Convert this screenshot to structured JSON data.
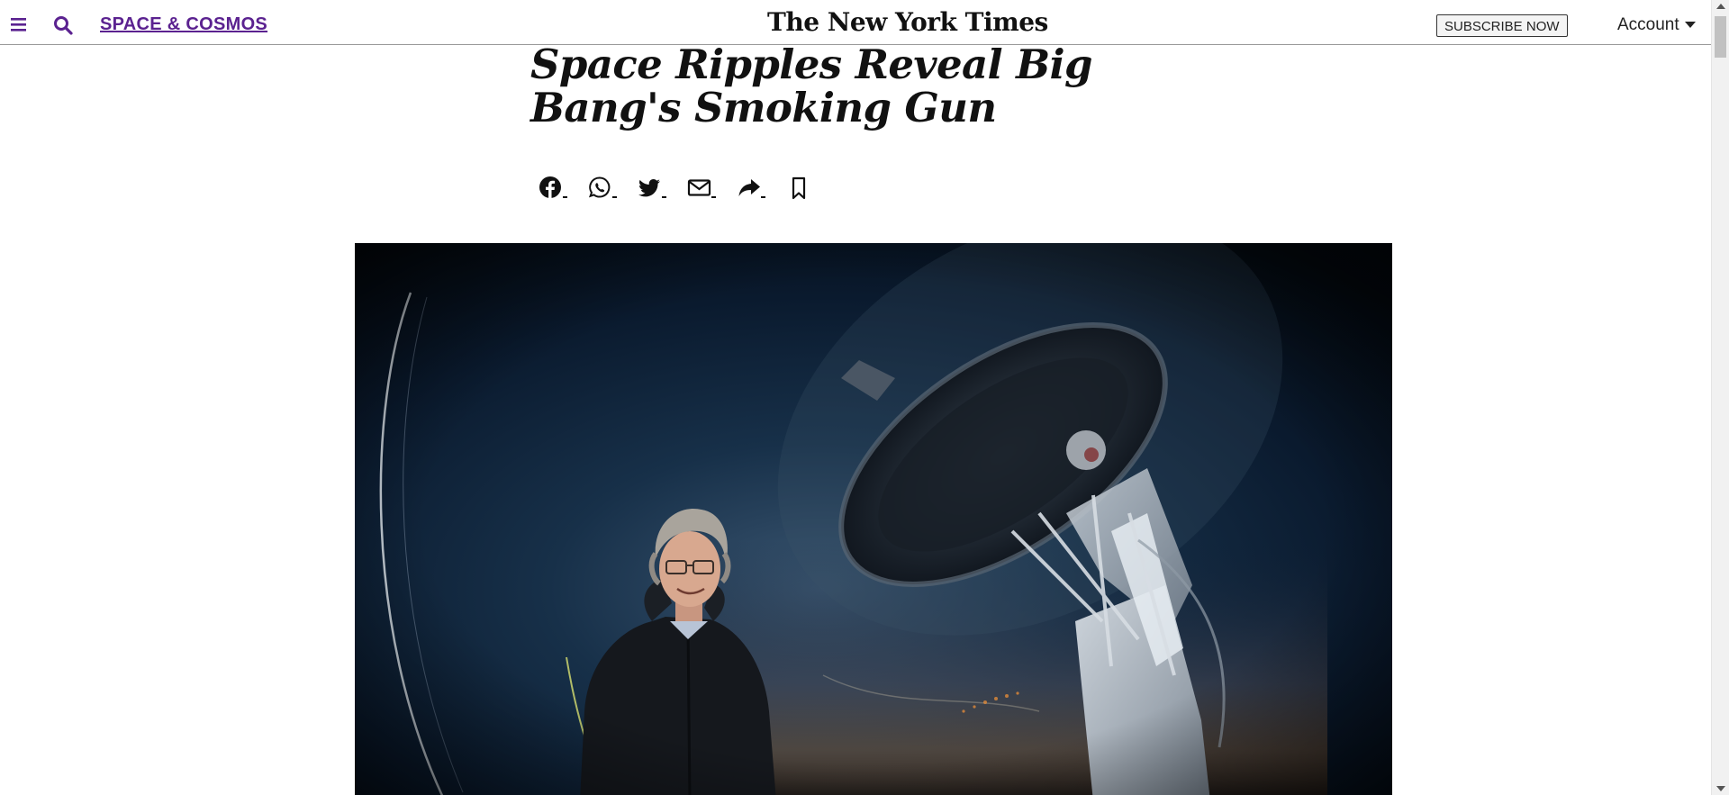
{
  "header": {
    "section_label": "SPACE & COSMOS",
    "logo_text": "The New York Times",
    "subscribe_label": "SUBSCRIBE NOW",
    "account_label": "Account"
  },
  "icons": {
    "menu": "hamburger-menu-icon",
    "search": "search-icon",
    "account_caret": "caret-down-icon"
  },
  "article": {
    "headline": "Space Ripples Reveal Big Bang's Smoking Gun"
  },
  "share_bar": [
    {
      "name": "facebook-share-button",
      "icon": "facebook-icon"
    },
    {
      "name": "whatsapp-share-button",
      "icon": "whatsapp-icon"
    },
    {
      "name": "twitter-share-button",
      "icon": "twitter-icon"
    },
    {
      "name": "email-share-button",
      "icon": "email-icon"
    },
    {
      "name": "more-share-button",
      "icon": "share-arrow-icon"
    },
    {
      "name": "save-article-button",
      "icon": "bookmark-icon"
    }
  ],
  "colors": {
    "section_link": "#5b2290",
    "text": "#111111",
    "header_border": "#9a9a9a",
    "photo_sky": "#06101c"
  }
}
